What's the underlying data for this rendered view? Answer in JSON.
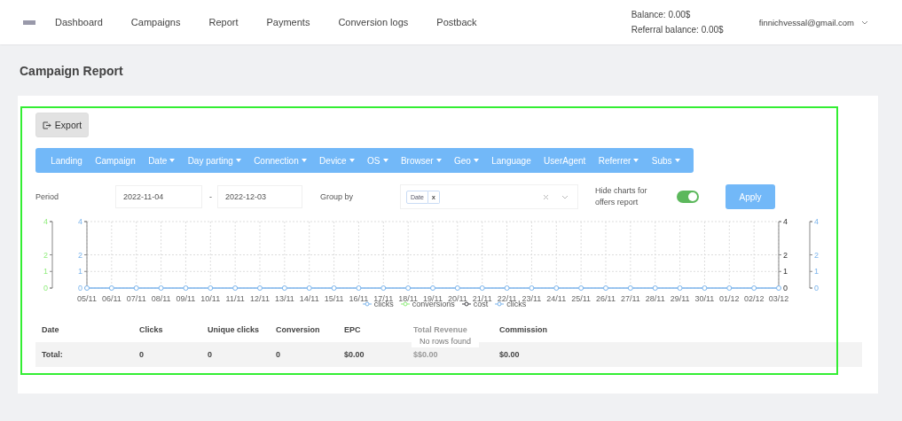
{
  "nav": {
    "items": [
      "Dashboard",
      "Campaigns",
      "Report",
      "Payments",
      "Conversion logs",
      "Postback"
    ],
    "balance": "Balance: 0.00$",
    "referral_balance": "Referral balance: 0.00$",
    "user_email": "finnichvessal@gmail.com"
  },
  "page_title": "Campaign Report",
  "export_button": "Export",
  "filter_tabs": [
    {
      "label": "Landing",
      "dropdown": false
    },
    {
      "label": "Campaign",
      "dropdown": false
    },
    {
      "label": "Date",
      "dropdown": true
    },
    {
      "label": "Day parting",
      "dropdown": true
    },
    {
      "label": "Connection",
      "dropdown": true
    },
    {
      "label": "Device",
      "dropdown": true
    },
    {
      "label": "OS",
      "dropdown": true
    },
    {
      "label": "Browser",
      "dropdown": true
    },
    {
      "label": "Geo",
      "dropdown": true
    },
    {
      "label": "Language",
      "dropdown": false
    },
    {
      "label": "UserAgent",
      "dropdown": false
    },
    {
      "label": "Referrer",
      "dropdown": true
    },
    {
      "label": "Subs",
      "dropdown": true
    }
  ],
  "filters": {
    "period_label": "Period",
    "date_from": "2022-11-04",
    "separator": "-",
    "date_to": "2022-12-03",
    "group_by_label": "Group by",
    "group_by_tags": [
      "Date"
    ],
    "tag_remove": "x",
    "hide_charts_label": "Hide charts for offers report",
    "hide_charts_on": true,
    "apply_button": "Apply"
  },
  "chart": {
    "extra_axes": {
      "left_outer": [
        "4",
        "2",
        "1",
        "0"
      ],
      "right_inner": [
        "4",
        "2",
        "1",
        "0"
      ],
      "right_outer": [
        "4",
        "2",
        "1",
        "0"
      ]
    },
    "chart_data": {
      "type": "line",
      "grid": true,
      "categories": [
        "05/11",
        "06/11",
        "07/11",
        "08/11",
        "09/11",
        "10/11",
        "11/11",
        "12/11",
        "13/11",
        "14/11",
        "15/11",
        "16/11",
        "17/11",
        "18/11",
        "19/11",
        "20/11",
        "21/11",
        "22/11",
        "23/11",
        "24/11",
        "25/11",
        "26/11",
        "27/11",
        "28/11",
        "29/11",
        "30/11",
        "01/12",
        "02/12",
        "03/12"
      ],
      "yticks": [
        0,
        1,
        2,
        4
      ],
      "ylim": [
        0,
        4
      ],
      "series": [
        {
          "name": "clicks",
          "color": "#7cb5ec",
          "marker": true,
          "values": [
            0,
            0,
            0,
            0,
            0,
            0,
            0,
            0,
            0,
            0,
            0,
            0,
            0,
            0,
            0,
            0,
            0,
            0,
            0,
            0,
            0,
            0,
            0,
            0,
            0,
            0,
            0,
            0,
            0
          ]
        },
        {
          "name": "conversions",
          "color": "#90ed7d",
          "marker": true,
          "values": [
            null,
            null,
            null,
            null,
            null,
            null,
            null,
            null,
            null,
            null,
            null,
            null,
            null,
            null,
            null,
            null,
            null,
            null,
            null,
            null,
            null,
            null,
            null,
            null,
            null,
            null,
            null,
            null,
            null
          ]
        },
        {
          "name": "cost",
          "color": "#434348",
          "marker": true,
          "values": [
            null,
            null,
            null,
            null,
            null,
            null,
            null,
            null,
            null,
            null,
            null,
            null,
            null,
            null,
            null,
            null,
            null,
            null,
            null,
            null,
            null,
            null,
            null,
            null,
            null,
            null,
            null,
            null,
            null
          ]
        },
        {
          "name": "clicks",
          "color": "#7cb5ec",
          "marker": true,
          "values": [
            null,
            null,
            null,
            null,
            null,
            null,
            null,
            null,
            null,
            null,
            null,
            null,
            null,
            null,
            null,
            null,
            null,
            null,
            null,
            null,
            null,
            null,
            null,
            null,
            null,
            null,
            null,
            null,
            null
          ]
        }
      ]
    }
  },
  "table": {
    "columns": [
      "Date",
      "Clicks",
      "Unique clicks",
      "Conversion",
      "EPC",
      "Total Revenue",
      "Commission"
    ],
    "total_row": [
      "Total:",
      "0",
      "0",
      "0",
      "$0.00",
      "$$0.00",
      "$0.00"
    ],
    "empty_message": "No rows found"
  }
}
